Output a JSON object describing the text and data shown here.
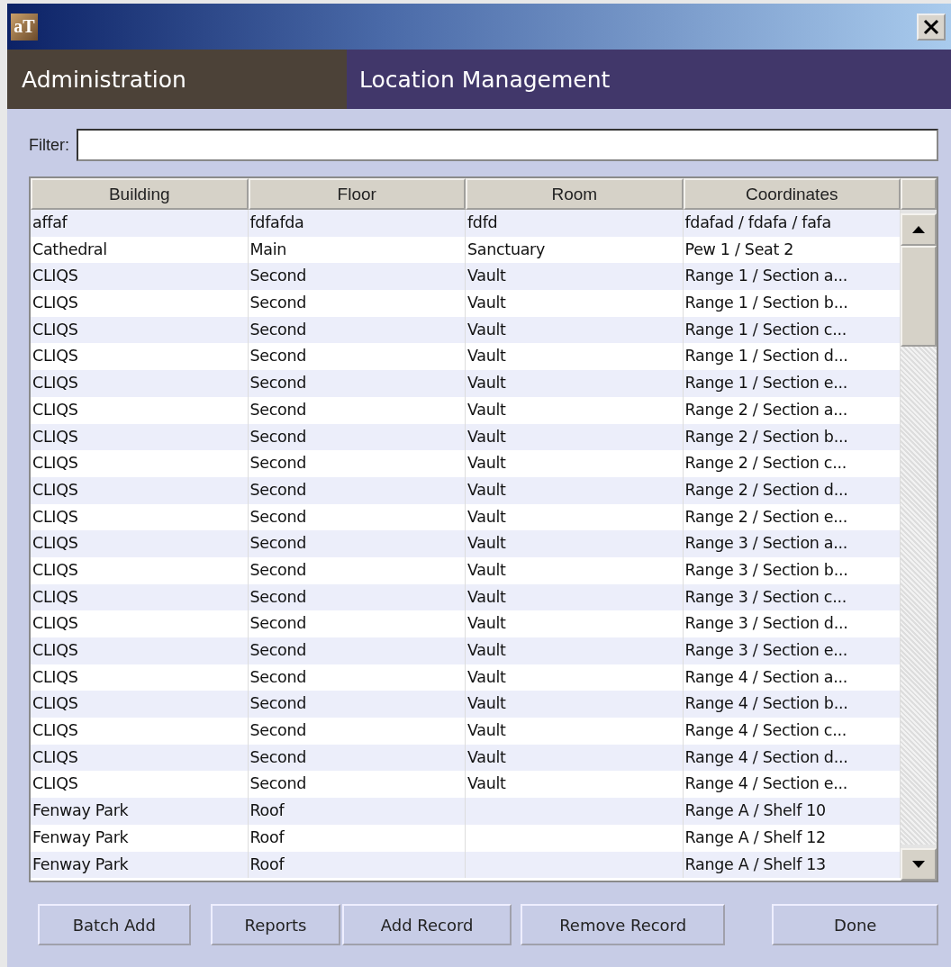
{
  "window": {
    "app_icon_text": "aT"
  },
  "banner": {
    "section": "Administration",
    "title": "Location Management"
  },
  "filter": {
    "label": "Filter:"
  },
  "table": {
    "columns": [
      "Building",
      "Floor",
      "Room",
      "Coordinates"
    ],
    "rows": [
      {
        "cells": [
          "affaf",
          "fdfafda",
          "fdfd",
          "fdafad / fdafa / fafa"
        ]
      },
      {
        "cells": [
          "Cathedral",
          "Main",
          "Sanctuary",
          "Pew 1 / Seat 2"
        ]
      },
      {
        "cells": [
          "CLIQS",
          "Second",
          "Vault",
          "Range 1 / Section a..."
        ]
      },
      {
        "cells": [
          "CLIQS",
          "Second",
          "Vault",
          "Range 1 / Section b..."
        ]
      },
      {
        "cells": [
          "CLIQS",
          "Second",
          "Vault",
          "Range 1 / Section c..."
        ]
      },
      {
        "cells": [
          "CLIQS",
          "Second",
          "Vault",
          "Range 1 / Section d..."
        ]
      },
      {
        "cells": [
          "CLIQS",
          "Second",
          "Vault",
          "Range 1 / Section e..."
        ]
      },
      {
        "cells": [
          "CLIQS",
          "Second",
          "Vault",
          "Range 2 / Section a..."
        ]
      },
      {
        "cells": [
          "CLIQS",
          "Second",
          "Vault",
          "Range 2 / Section b..."
        ]
      },
      {
        "cells": [
          "CLIQS",
          "Second",
          "Vault",
          "Range 2 / Section c..."
        ]
      },
      {
        "cells": [
          "CLIQS",
          "Second",
          "Vault",
          "Range 2 / Section d..."
        ]
      },
      {
        "cells": [
          "CLIQS",
          "Second",
          "Vault",
          "Range 2 / Section e..."
        ]
      },
      {
        "cells": [
          "CLIQS",
          "Second",
          "Vault",
          "Range 3 / Section a..."
        ]
      },
      {
        "cells": [
          "CLIQS",
          "Second",
          "Vault",
          "Range 3 / Section b..."
        ]
      },
      {
        "cells": [
          "CLIQS",
          "Second",
          "Vault",
          "Range 3 / Section c..."
        ]
      },
      {
        "cells": [
          "CLIQS",
          "Second",
          "Vault",
          "Range 3 / Section d..."
        ]
      },
      {
        "cells": [
          "CLIQS",
          "Second",
          "Vault",
          "Range 3 / Section e..."
        ]
      },
      {
        "cells": [
          "CLIQS",
          "Second",
          "Vault",
          "Range 4 / Section a..."
        ]
      },
      {
        "cells": [
          "CLIQS",
          "Second",
          "Vault",
          "Range 4 / Section b..."
        ]
      },
      {
        "cells": [
          "CLIQS",
          "Second",
          "Vault",
          "Range 4 / Section c..."
        ]
      },
      {
        "cells": [
          "CLIQS",
          "Second",
          "Vault",
          "Range 4 / Section d..."
        ]
      },
      {
        "cells": [
          "CLIQS",
          "Second",
          "Vault",
          "Range 4 / Section e..."
        ]
      },
      {
        "cells": [
          "Fenway Park",
          "Roof",
          "",
          "Range A / Shelf 10"
        ]
      },
      {
        "cells": [
          "Fenway Park",
          "Roof",
          "",
          "Range A / Shelf 12"
        ]
      },
      {
        "cells": [
          "Fenway Park",
          "Roof",
          "",
          "Range A / Shelf 13"
        ]
      }
    ]
  },
  "buttons": [
    "Batch Add",
    "Reports",
    "Add Record",
    "Remove Record",
    "Done"
  ]
}
